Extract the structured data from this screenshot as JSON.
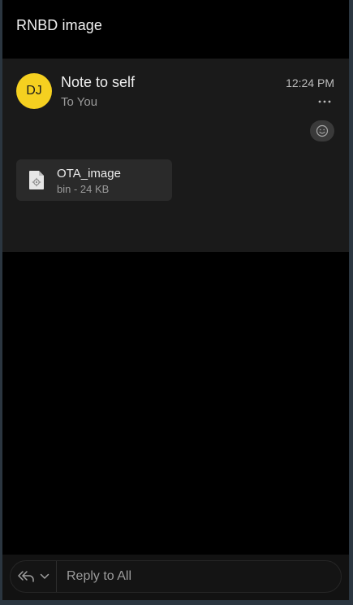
{
  "header": {
    "title": "RNBD image"
  },
  "message": {
    "avatar_initials": "DJ",
    "avatar_color": "#f5d020",
    "sender": "Note to self",
    "recipient": "To You",
    "time": "12:24 PM"
  },
  "attachment": {
    "name": "OTA_image",
    "meta": "bin - 24 KB"
  },
  "footer": {
    "reply_label": "Reply to All"
  },
  "icons": {
    "more": "more-horizontal-icon",
    "reaction": "smiley-icon",
    "file": "file-settings-icon",
    "reply_all": "reply-all-icon",
    "dropdown": "chevron-down-icon"
  }
}
